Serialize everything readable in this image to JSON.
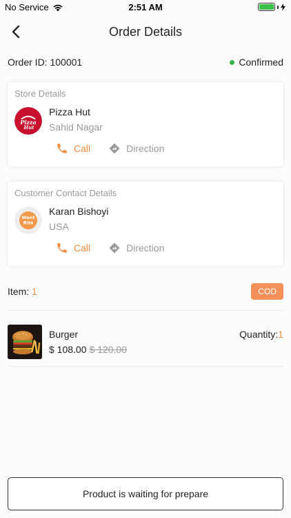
{
  "status_bar": {
    "carrier": "No Service",
    "time": "2:51 AM",
    "battery_color": "#3cc24a"
  },
  "nav": {
    "title": "Order Details",
    "back_icon": "chevron-left-icon"
  },
  "order": {
    "id_text": "Order ID: 100001",
    "status": "Confirmed",
    "status_color": "#36b24a"
  },
  "store": {
    "section_title": "Store Details",
    "name": "Pizza Hut",
    "location": "Sahid Nagar",
    "call_label": "Call",
    "direction_label": "Direction"
  },
  "customer": {
    "section_title": "Customer Contact Details",
    "name": "Karan Bishoyi",
    "location": "USA",
    "call_label": "Call",
    "direction_label": "Direction"
  },
  "items": {
    "label": "Item: ",
    "count": "1",
    "payment_badge": "COD"
  },
  "products": [
    {
      "name": "Burger",
      "price": "$ 108.00",
      "old_price": "$ 120.00",
      "quantity_label": "Quantity:",
      "quantity": "1"
    }
  ],
  "footer": {
    "button_label": "Product is waiting for prepare"
  },
  "colors": {
    "accent": "#f08a3c",
    "badge": "#f6905a",
    "muted": "#9a9a9a"
  }
}
